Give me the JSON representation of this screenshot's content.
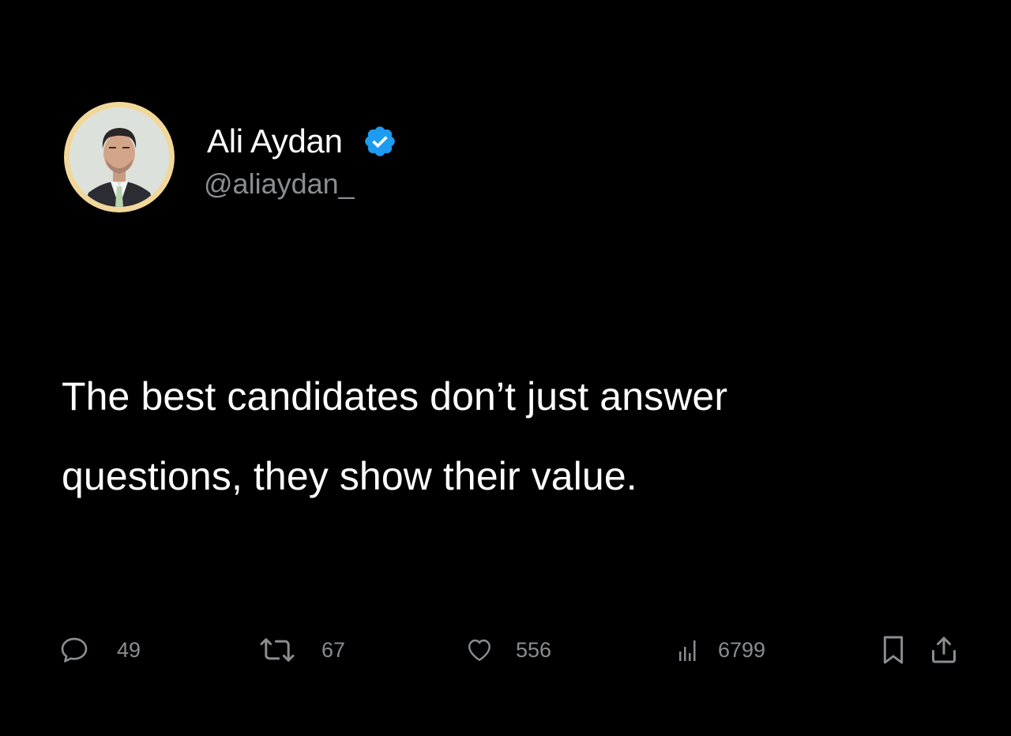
{
  "author": {
    "display_name": "Ali Aydan",
    "handle": "@aliaydan_",
    "verified": true,
    "verified_badge_color": "#1d9bf0",
    "avatar_ring_color": "#f1d79a"
  },
  "tweet": {
    "text_lines": [
      "The best candidates don’t just answer",
      "questions, they show their value."
    ]
  },
  "actions": {
    "replies": {
      "icon": "reply-icon",
      "count": "49"
    },
    "retweets": {
      "icon": "retweet-icon",
      "count": "67"
    },
    "likes": {
      "icon": "heart-icon",
      "count": "556"
    },
    "views": {
      "icon": "views-chart-icon",
      "count": "6799"
    },
    "bookmark": {
      "icon": "bookmark-icon"
    },
    "share": {
      "icon": "share-icon"
    }
  },
  "theme": {
    "background": "#000000",
    "text_primary": "#ffffff",
    "text_secondary": "#8a8d91"
  }
}
